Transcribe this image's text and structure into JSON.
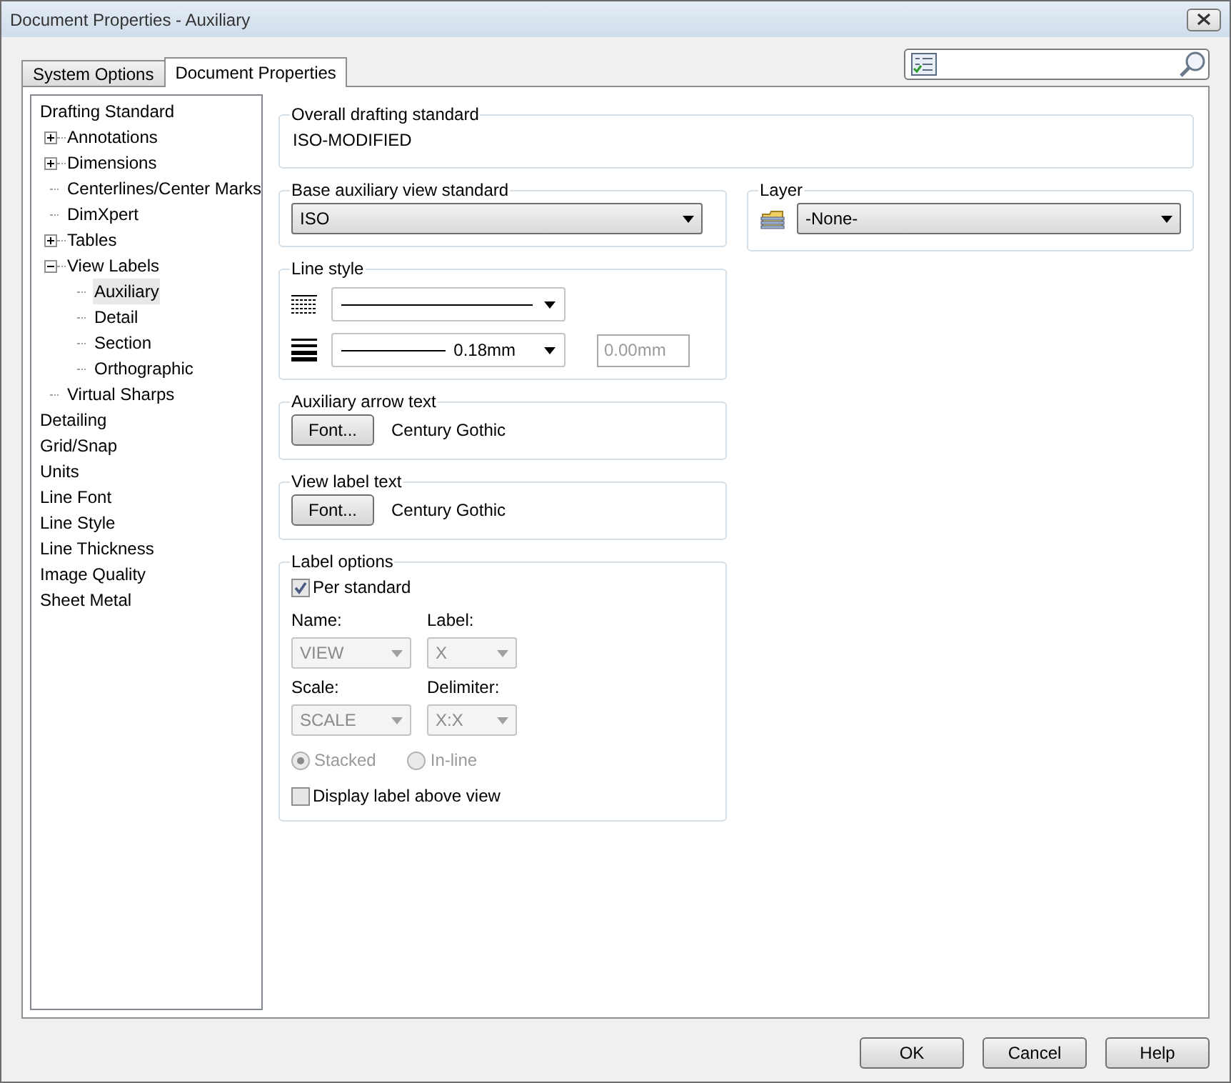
{
  "window": {
    "title": "Document Properties - Auxiliary"
  },
  "tabs": [
    {
      "label": "System Options",
      "selected": false
    },
    {
      "label": "Document Properties",
      "selected": true
    }
  ],
  "tree": [
    {
      "label": "Drafting Standard",
      "selected": false,
      "children": [
        {
          "label": "Annotations",
          "selected": false,
          "expanded": false
        },
        {
          "label": "Dimensions",
          "selected": false,
          "expanded": false
        },
        {
          "label": "Centerlines/Center Marks",
          "selected": false
        },
        {
          "label": "DimXpert",
          "selected": false
        },
        {
          "label": "Tables",
          "selected": false,
          "expanded": false
        },
        {
          "label": "View Labels",
          "selected": false,
          "expanded": true,
          "children": [
            {
              "label": "Auxiliary",
              "selected": true
            },
            {
              "label": "Detail",
              "selected": false
            },
            {
              "label": "Section",
              "selected": false
            },
            {
              "label": "Orthographic",
              "selected": false
            }
          ]
        },
        {
          "label": "Virtual Sharps",
          "selected": false
        }
      ]
    },
    {
      "label": "Detailing",
      "selected": false
    },
    {
      "label": "Grid/Snap",
      "selected": false
    },
    {
      "label": "Units",
      "selected": false
    },
    {
      "label": "Line Font",
      "selected": false
    },
    {
      "label": "Line Style",
      "selected": false
    },
    {
      "label": "Line Thickness",
      "selected": false
    },
    {
      "label": "Image Quality",
      "selected": false
    },
    {
      "label": "Sheet Metal",
      "selected": false
    }
  ],
  "overall_drafting_standard": {
    "title": "Overall drafting standard",
    "value": "ISO-MODIFIED"
  },
  "base_auxiliary_view_standard": {
    "title": "Base auxiliary view standard",
    "value": "ISO"
  },
  "layer": {
    "title": "Layer",
    "value": "-None-"
  },
  "line_style": {
    "title": "Line style",
    "thickness": "0.18mm",
    "custom_thickness": {
      "value": "0.00mm",
      "disabled": true
    }
  },
  "auxiliary_arrow_text": {
    "title": "Auxiliary arrow text",
    "button": "Font...",
    "font": "Century Gothic"
  },
  "view_label_text": {
    "title": "View label text",
    "button": "Font...",
    "font": "Century Gothic"
  },
  "label_options": {
    "title": "Label options",
    "per_standard": {
      "label": "Per standard",
      "checked": true
    },
    "fields": [
      {
        "label": "Name:",
        "value": "VIEW",
        "disabled": true
      },
      {
        "label": "Label:",
        "value": "X",
        "disabled": true
      },
      {
        "label": "Scale:",
        "value": "SCALE",
        "disabled": true
      },
      {
        "label": "Delimiter:",
        "value": "X:X",
        "disabled": true
      }
    ],
    "radios": [
      {
        "label": "Stacked",
        "selected": true,
        "disabled": true
      },
      {
        "label": "In-line",
        "selected": false,
        "disabled": true
      }
    ],
    "display_label_above_view": {
      "label": "Display label above view",
      "checked": false
    }
  },
  "buttons": [
    "OK",
    "Cancel",
    "Help"
  ]
}
